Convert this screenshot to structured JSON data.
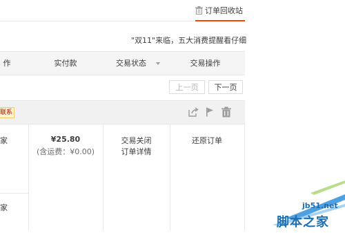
{
  "tabs": {
    "recycle_bin": {
      "label": "订单回收站",
      "icon": "trash-icon"
    }
  },
  "notice": {
    "text": "\"双11\"来临，五大消费提醒看仔细"
  },
  "table_header": {
    "col_action_partial": "作",
    "col_paid": "实付款",
    "col_status": "交易状态",
    "col_operations": "交易操作"
  },
  "pager": {
    "prev": "上一页",
    "next": "下一页"
  },
  "order": {
    "contact_badge": "联系",
    "row1_item_partial": "家",
    "row2_item_partial": "家",
    "price": "¥25.80",
    "shipping": "(含运费：¥0.00)",
    "status": "交易关闭",
    "detail_link": "订单详情",
    "restore_link": "还原订单"
  },
  "watermark": {
    "site": "jb51.net",
    "name": "脚本之家"
  },
  "colors": {
    "accent": "#ff4400",
    "badge_bg": "#fff5cc",
    "badge_text": "#c40000"
  }
}
